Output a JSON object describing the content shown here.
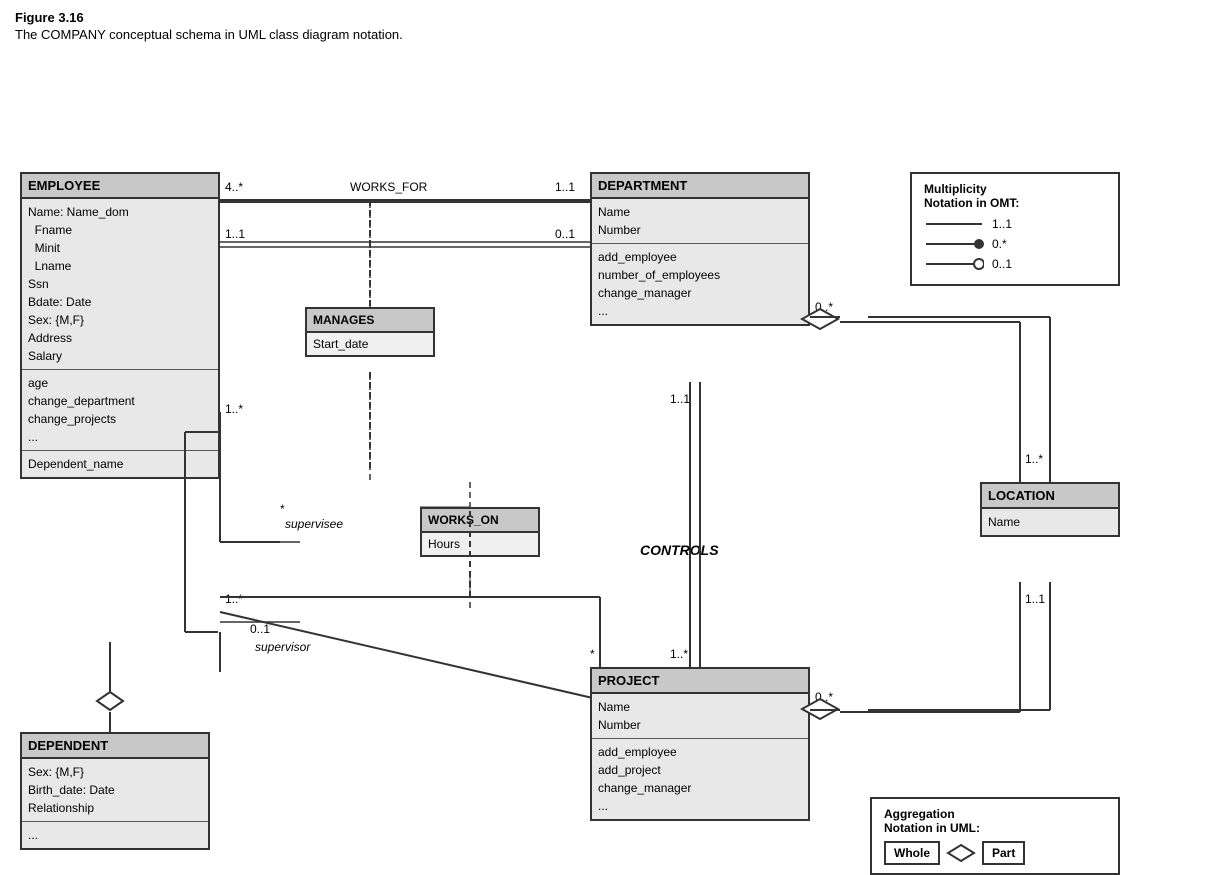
{
  "figure": {
    "title": "Figure 3.16",
    "caption": "The COMPANY conceptual schema in UML class diagram notation."
  },
  "classes": {
    "employee": {
      "header": "EMPLOYEE",
      "section1": [
        "Name: Name_dom",
        "  Fname",
        "  Minit",
        "  Lname",
        "Ssn",
        "Bdate: Date",
        "Sex: {M,F}",
        "Address",
        "Salary"
      ],
      "section2": [
        "age",
        "change_department",
        "change_projects",
        "..."
      ],
      "section3": [
        "Dependent_name"
      ]
    },
    "department": {
      "header": "DEPARTMENT",
      "section1": [
        "Name",
        "Number"
      ],
      "section2": [
        "add_employee",
        "number_of_employees",
        "change_manager",
        "..."
      ]
    },
    "project": {
      "header": "PROJECT",
      "section1": [
        "Name",
        "Number"
      ],
      "section2": [
        "add_employee",
        "add_project",
        "change_manager",
        "..."
      ]
    },
    "dependent": {
      "header": "DEPENDENT",
      "section1": [
        "Sex: {M,F}",
        "Birth_date: Date",
        "Relationship"
      ],
      "section2": [
        "..."
      ]
    },
    "location": {
      "header": "LOCATION",
      "section1": [
        "Name"
      ]
    }
  },
  "assoc_boxes": {
    "manages": {
      "header": "MANAGES",
      "attr": "Start_date"
    },
    "works_on": {
      "header": "WORKS_ON",
      "attr": "Hours"
    }
  },
  "labels": {
    "works_for": "WORKS_FOR",
    "controls": "CONTROLS",
    "supervisee": "supervisee",
    "supervisor": "supervisor",
    "mult_4star": "4..*",
    "mult_11a": "1..1",
    "mult_11b": "1..1",
    "mult_011": "0..1",
    "mult_1star_a": "1..*",
    "mult_star_a": "*",
    "mult_0star_a": "0..*",
    "mult_11c": "1..1",
    "mult_1star_b": "1..*",
    "mult_star_b": "*",
    "mult_0star_b": "0..*",
    "mult_0star_c": "0..*",
    "mult_1star_c": "1..*",
    "mult_011b": "0..1",
    "mult_11d": "1..1"
  },
  "multiplicity_notation": {
    "title1": "Multiplicity",
    "title2": "Notation in OMT:",
    "rows": [
      {
        "label": "1..1"
      },
      {
        "label": "0.*"
      },
      {
        "label": "0..1"
      }
    ]
  },
  "aggregation_notation": {
    "title1": "Aggregation",
    "title2": "Notation in UML:",
    "whole": "Whole",
    "part": "Part"
  }
}
